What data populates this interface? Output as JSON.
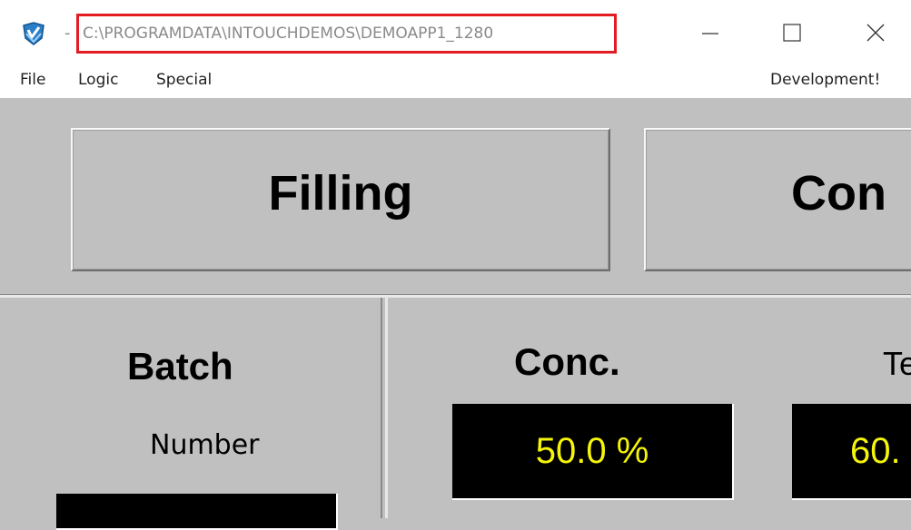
{
  "titlebar": {
    "prefix": "-",
    "path": "C:\\PROGRAMDATA\\INTOUCHDEMOS\\DEMOAPP1_1280",
    "icon": "intouch-app-icon",
    "controls": {
      "minimize_icon": "minimize-icon",
      "maximize_icon": "maximize-icon",
      "close_icon": "close-icon"
    }
  },
  "menubar": {
    "items": [
      "File",
      "Logic",
      "Special"
    ],
    "right_label": "Development!"
  },
  "buttons": {
    "filling": "Filling",
    "second": "Con"
  },
  "batch": {
    "title": "Batch",
    "subtitle": "Number"
  },
  "conc": {
    "title": "Conc.",
    "value": "50.0 %"
  },
  "temp": {
    "title": "Te",
    "value": "60."
  },
  "colors": {
    "background": "#c0c0c0",
    "highlight_border": "#e31b23",
    "readout_background": "#000000",
    "readout_text": "#f5f50a"
  }
}
